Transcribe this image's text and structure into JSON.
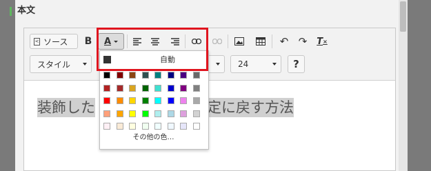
{
  "section": {
    "title": "本文"
  },
  "toolbar": {
    "source_label": "ソース",
    "bold_label": "B",
    "font_color_label": "A",
    "style_combo": "スタイル",
    "size_combo": "24",
    "help_label": "?",
    "clear_format_label": "T"
  },
  "editor": {
    "content_left": "装飾した",
    "content_right": "定に戻す方法"
  },
  "color_palette": {
    "auto_label": "自動",
    "more_colors_label": "その他の色…",
    "auto_color": "#333333",
    "rows": [
      [
        "#000000",
        "#800000",
        "#8b4513",
        "#2f4f4f",
        "#008080",
        "#000080",
        "#4b0082",
        "#696969"
      ],
      [
        "#b22222",
        "#a52a2a",
        "#daa520",
        "#006400",
        "#40e0d0",
        "#0000cd",
        "#800080",
        "#808080"
      ],
      [
        "#ff0000",
        "#ff8c00",
        "#ffd700",
        "#008000",
        "#00ffff",
        "#0000ff",
        "#ee82ee",
        "#a9a9a9"
      ],
      [
        "#ffa07a",
        "#ffa500",
        "#ffff00",
        "#00ff00",
        "#afeeee",
        "#add8e6",
        "#dda0dd",
        "#d3d3d3"
      ],
      [
        "#fff0f5",
        "#faebd7",
        "#ffffe0",
        "#f0fff0",
        "#f0ffff",
        "#f0f8ff",
        "#e6e6fa",
        "#ffffff"
      ]
    ]
  },
  "highlight_color": "#e0151f"
}
